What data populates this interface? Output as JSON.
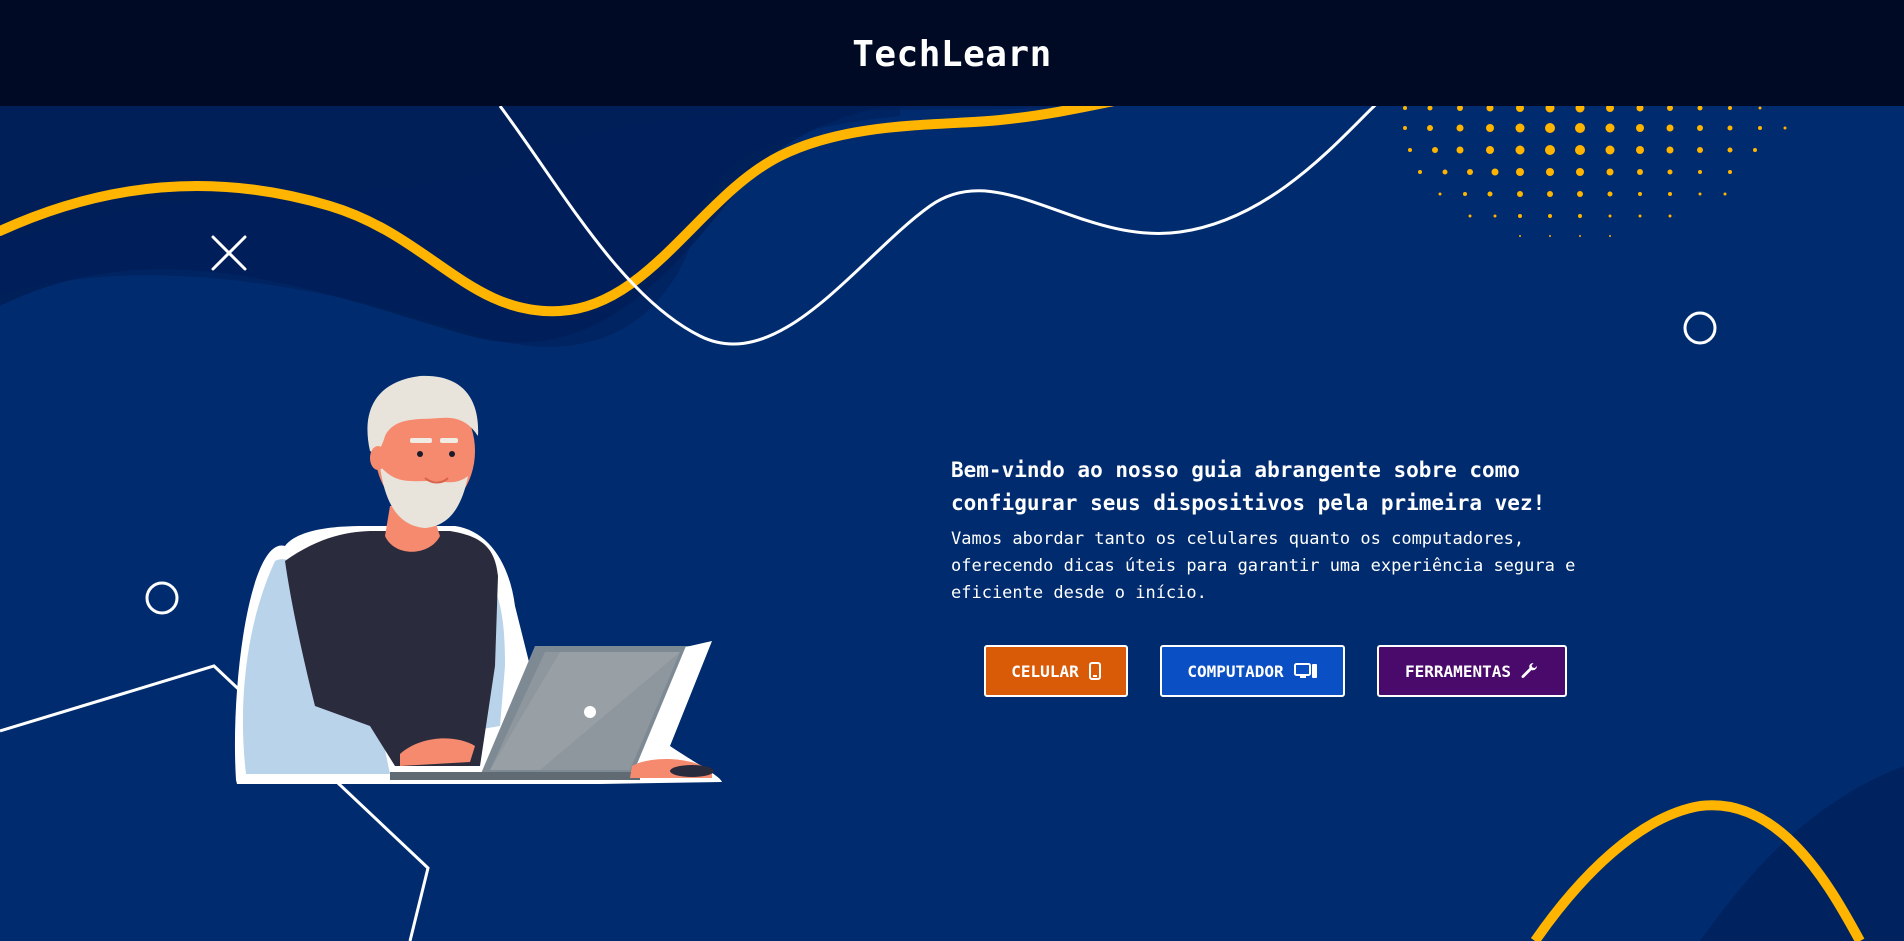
{
  "header": {
    "brand": "TechLearn"
  },
  "hero": {
    "headline": "Bem-vindo ao nosso guia abrangente sobre como configurar seus dispositivos pela primeira vez!",
    "subtext": "Vamos abordar tanto os celulares quanto os computadores, oferecendo dicas úteis para garantir uma experiência segura e eficiente desde o início.",
    "buttons": [
      {
        "label": "CELULAR",
        "icon": "smartphone-icon",
        "color": "#d95b07"
      },
      {
        "label": "COMPUTADOR",
        "icon": "desktop-computer-icon",
        "color": "#0a4fc4"
      },
      {
        "label": "FERRAMENTAS",
        "icon": "wrench-icon",
        "color": "#4a0a6b"
      }
    ]
  },
  "colors": {
    "background": "#002b6e",
    "header": "#000a24",
    "accent_yellow": "#ffb400"
  }
}
